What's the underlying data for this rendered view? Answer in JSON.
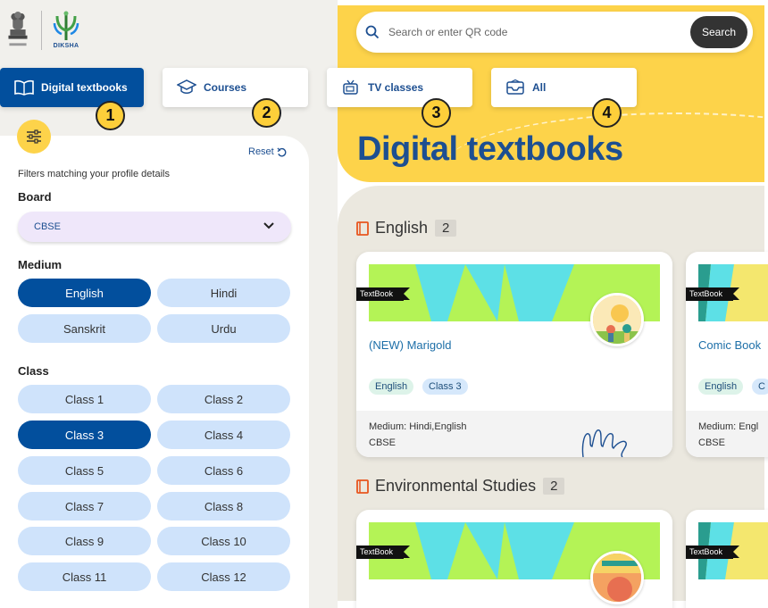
{
  "logo": {
    "caption": "DIKSHA"
  },
  "search": {
    "placeholder": "Search or enter QR code",
    "button": "Search"
  },
  "tabs": [
    {
      "label": "Digital textbooks",
      "number": "1"
    },
    {
      "label": "Courses",
      "number": "2"
    },
    {
      "label": "TV classes",
      "number": "3"
    },
    {
      "label": "All",
      "number": "4"
    }
  ],
  "heading": "Digital textbooks",
  "filters": {
    "reset": "Reset",
    "caption": "Filters matching your profile details",
    "board_label": "Board",
    "board_value": "CBSE",
    "medium_label": "Medium",
    "medium": [
      "English",
      "Hindi",
      "Sanskrit",
      "Urdu"
    ],
    "medium_selected": "English",
    "class_label": "Class",
    "classes": [
      "Class 1",
      "Class 2",
      "Class 3",
      "Class 4",
      "Class 5",
      "Class 6",
      "Class 7",
      "Class 8",
      "Class 9",
      "Class 10",
      "Class 11",
      "Class 12"
    ],
    "class_selected": "Class 3"
  },
  "sections": [
    {
      "title": "English",
      "count": "2",
      "cards": [
        {
          "tag": "TextBook",
          "title": "(NEW) Marigold",
          "chips": [
            "English",
            "Class 3"
          ],
          "medium": "Medium: Hindi,English",
          "board": "CBSE"
        },
        {
          "tag": "TextBook",
          "title": "Comic Book",
          "chips": [
            "English",
            "C"
          ],
          "medium": "Medium: Engl",
          "board": "CBSE"
        }
      ]
    },
    {
      "title": "Environmental Studies",
      "count": "2",
      "cards": [
        {
          "tag": "TextBook"
        },
        {
          "tag": "TextBook"
        }
      ]
    }
  ],
  "colors": {
    "primary": "#024f9d",
    "accent_yellow": "#fdd34a",
    "pill": "#cfe3fb",
    "banner_green": "#b4f356",
    "banner_teal": "#5de0e6"
  }
}
